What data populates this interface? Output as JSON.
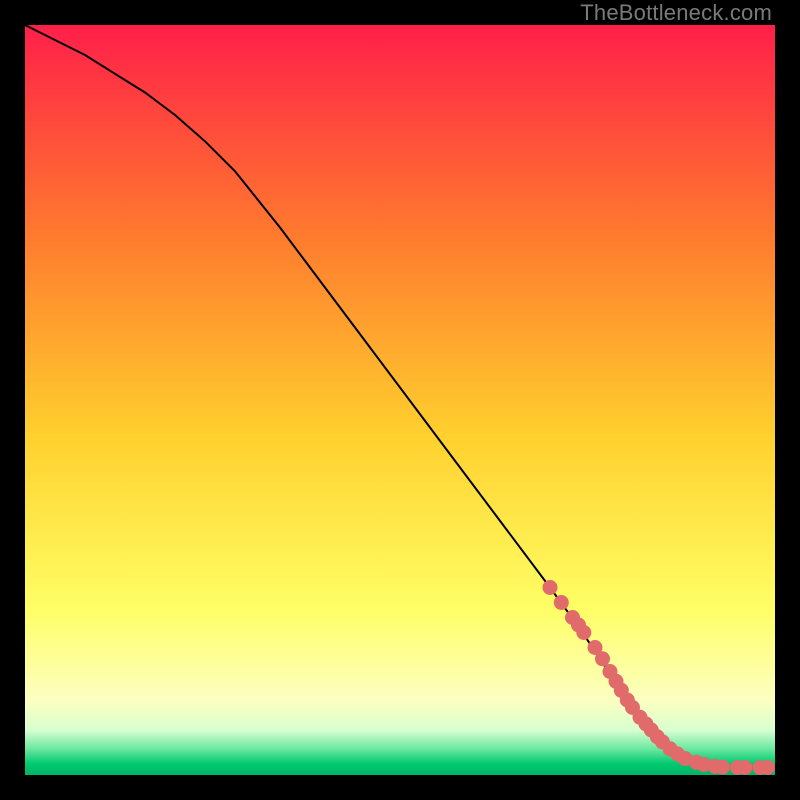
{
  "watermark": "TheBottleneck.com",
  "colors": {
    "gradient_top": "#ff1f49",
    "gradient_mid_upper": "#ff7a2e",
    "gradient_mid": "#ffd12e",
    "gradient_mid_lower": "#ffff66",
    "gradient_low": "#fcffc0",
    "gradient_green1": "#6be8a0",
    "gradient_green2": "#00c971",
    "line": "#000000",
    "marker": "#e16a6b",
    "bg": "#000000"
  },
  "chart_data": {
    "type": "line",
    "title": "",
    "xlabel": "",
    "ylabel": "",
    "xlim": [
      0,
      100
    ],
    "ylim": [
      0,
      100
    ],
    "series": [
      {
        "name": "curve",
        "x": [
          0,
          4,
          8,
          12,
          16,
          20,
          24,
          28,
          34,
          40,
          46,
          52,
          58,
          64,
          70,
          74,
          78,
          80,
          82,
          85,
          88,
          91,
          94,
          97,
          100
        ],
        "y": [
          100,
          98,
          96,
          93.5,
          91,
          88,
          84.5,
          80.5,
          73,
          65,
          57,
          49,
          41,
          33,
          25,
          19.5,
          13.5,
          10,
          7.5,
          4.5,
          2.2,
          1.3,
          1.0,
          1.0,
          1.0
        ]
      }
    ],
    "markers": {
      "name": "highlight-points",
      "x": [
        70,
        71.5,
        73,
        73.8,
        74.5,
        76,
        77,
        78,
        78.8,
        79.5,
        80.3,
        81,
        82,
        82.8,
        83.5,
        84.3,
        85,
        86,
        87,
        88,
        89.5,
        90.5,
        92,
        93,
        95,
        96,
        98,
        99
      ],
      "y": [
        25,
        23,
        21,
        20,
        19,
        17,
        15.5,
        13.8,
        12.5,
        11.3,
        10,
        9,
        7.7,
        6.8,
        6,
        5.1,
        4.4,
        3.5,
        2.8,
        2.2,
        1.7,
        1.4,
        1.15,
        1.05,
        1.0,
        1.0,
        1.0,
        1.0
      ]
    }
  }
}
